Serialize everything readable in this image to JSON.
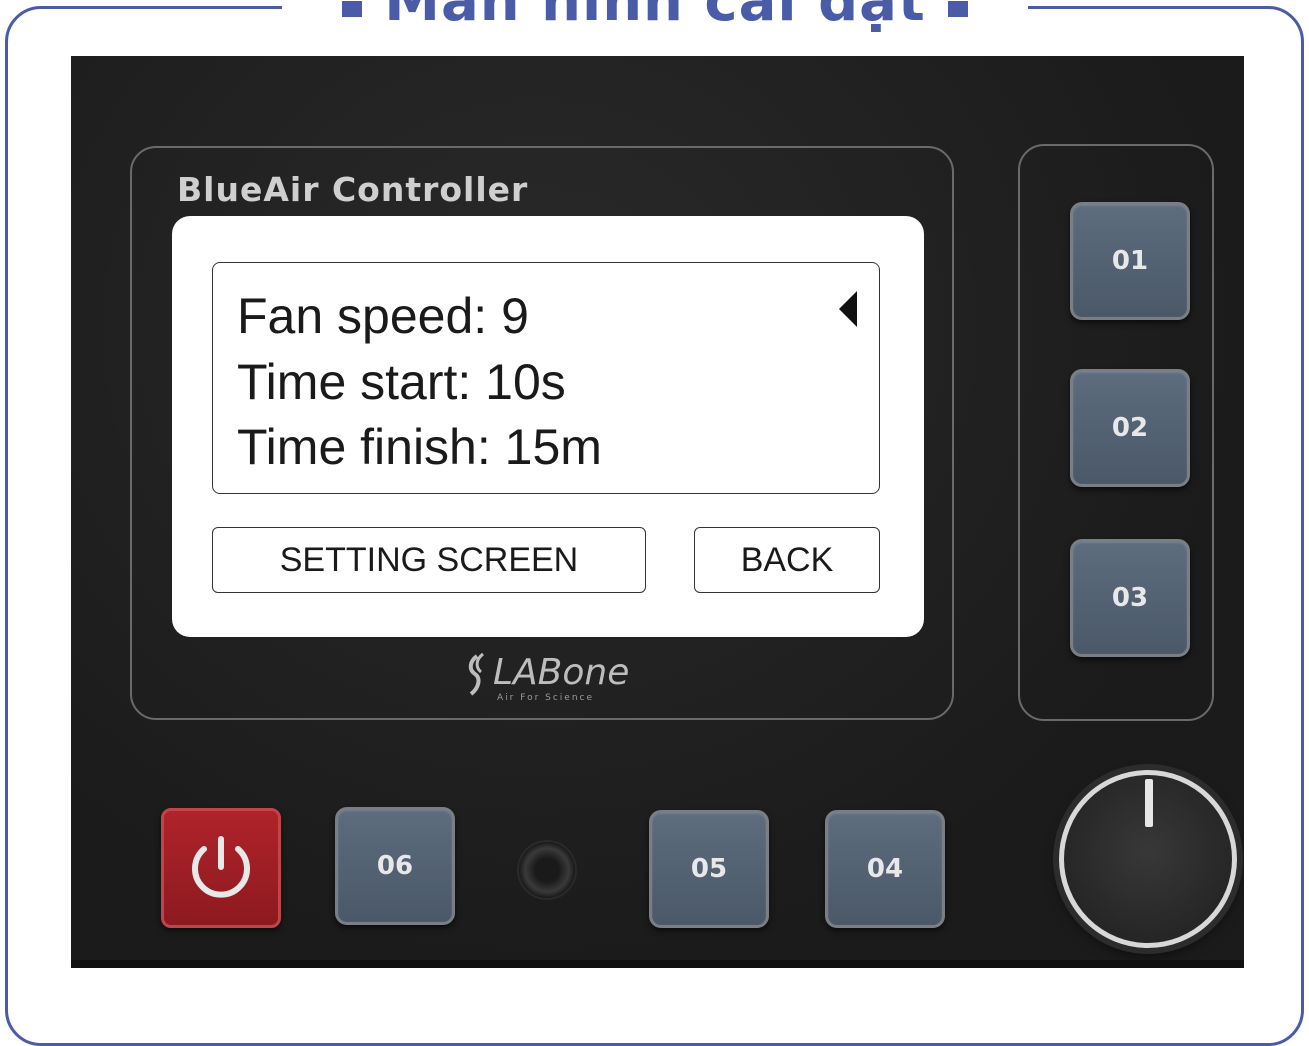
{
  "page": {
    "title": "Màn hình cài đặt"
  },
  "device": {
    "brand": "BlueAir Controller",
    "logo_text": "LABone",
    "logo_tagline": "Air For Science",
    "power_icon": "power-icon"
  },
  "screen": {
    "lines": [
      "Fan speed: 9",
      "Time start: 10s",
      "Time finish: 15m"
    ],
    "selected_line": 0,
    "buttons": {
      "setting": "SETTING SCREEN",
      "back": "BACK"
    }
  },
  "hardware_buttons": {
    "b01": "01",
    "b02": "02",
    "b03": "03",
    "b04": "04",
    "b05": "05",
    "b06": "06"
  },
  "colors": {
    "frame_accent": "#4a5ca8",
    "device_body": "#1e1e1e",
    "button_blue_grey": "#55647a",
    "power_red": "#a01f25"
  }
}
